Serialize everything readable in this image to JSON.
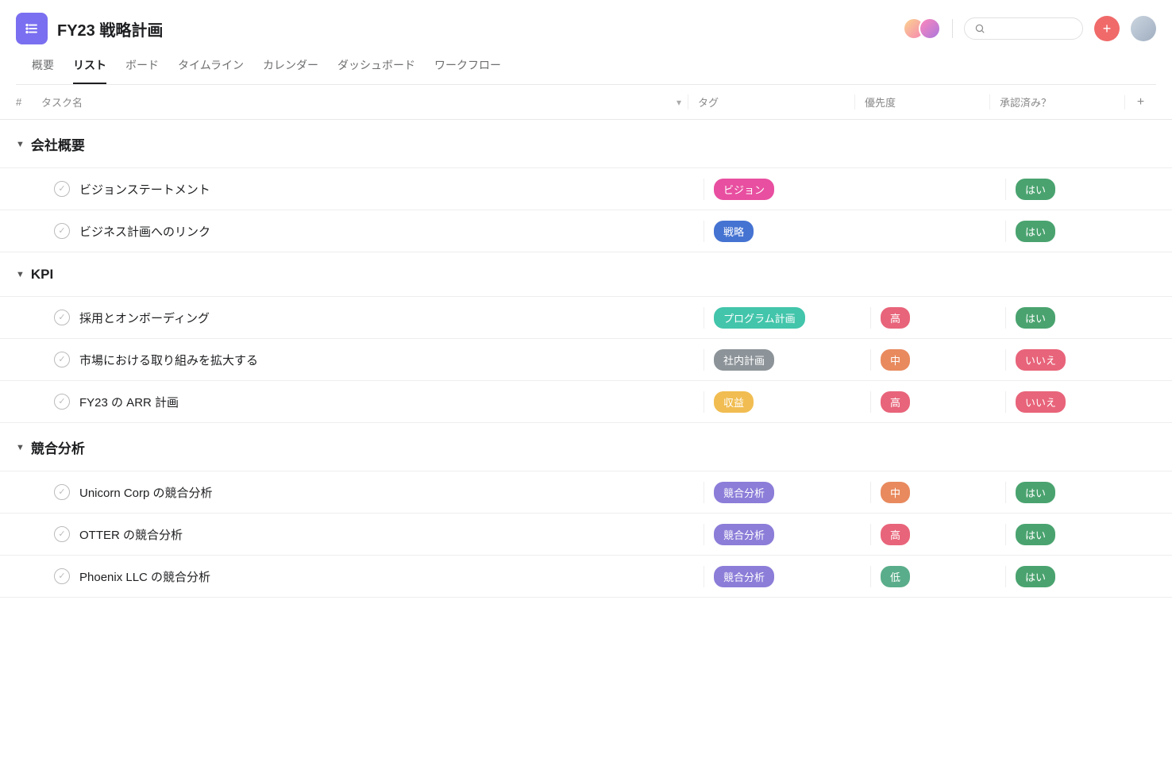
{
  "project": {
    "title": "FY23 戦略計画"
  },
  "tabs": [
    {
      "label": "概要",
      "active": false
    },
    {
      "label": "リスト",
      "active": true
    },
    {
      "label": "ボード",
      "active": false
    },
    {
      "label": "タイムライン",
      "active": false
    },
    {
      "label": "カレンダー",
      "active": false
    },
    {
      "label": "ダッシュボード",
      "active": false
    },
    {
      "label": "ワークフロー",
      "active": false
    }
  ],
  "columns": {
    "hash": "#",
    "name": "タスク名",
    "tag": "タグ",
    "priority": "優先度",
    "approved": "承認済み？"
  },
  "sections": [
    {
      "name": "会社概要",
      "tasks": [
        {
          "name": "ビジョンステートメント",
          "tag": {
            "label": "ビジョン",
            "color": "#e84fa0"
          },
          "priority": null,
          "approved": {
            "label": "はい",
            "color": "#4aa36f"
          }
        },
        {
          "name": "ビジネス計画へのリンク",
          "tag": {
            "label": "戦略",
            "color": "#4573d2"
          },
          "priority": null,
          "approved": {
            "label": "はい",
            "color": "#4aa36f"
          }
        }
      ]
    },
    {
      "name": "KPI",
      "tasks": [
        {
          "name": "採用とオンボーディング",
          "tag": {
            "label": "プログラム計画",
            "color": "#42c5ab"
          },
          "priority": {
            "label": "高",
            "color": "#e8647a"
          },
          "approved": {
            "label": "はい",
            "color": "#4aa36f"
          }
        },
        {
          "name": "市場における取り組みを拡大する",
          "tag": {
            "label": "社内計画",
            "color": "#8d9499"
          },
          "priority": {
            "label": "中",
            "color": "#e88a5e"
          },
          "approved": {
            "label": "いいえ",
            "color": "#e8647a"
          }
        },
        {
          "name": "FY23 の ARR 計画",
          "tag": {
            "label": "収益",
            "color": "#f1bd52"
          },
          "priority": {
            "label": "高",
            "color": "#e8647a"
          },
          "approved": {
            "label": "いいえ",
            "color": "#e8647a"
          }
        }
      ]
    },
    {
      "name": "競合分析",
      "tasks": [
        {
          "name": "Unicorn Corp の競合分析",
          "tag": {
            "label": "競合分析",
            "color": "#8b7dd8"
          },
          "priority": {
            "label": "中",
            "color": "#e88a5e"
          },
          "approved": {
            "label": "はい",
            "color": "#4aa36f"
          }
        },
        {
          "name": "OTTER の競合分析",
          "tag": {
            "label": "競合分析",
            "color": "#8b7dd8"
          },
          "priority": {
            "label": "高",
            "color": "#e8647a"
          },
          "approved": {
            "label": "はい",
            "color": "#4aa36f"
          }
        },
        {
          "name": "Phoenix LLC の競合分析",
          "tag": {
            "label": "競合分析",
            "color": "#8b7dd8"
          },
          "priority": {
            "label": "低",
            "color": "#5aad8a"
          },
          "approved": {
            "label": "はい",
            "color": "#4aa36f"
          }
        }
      ]
    }
  ]
}
